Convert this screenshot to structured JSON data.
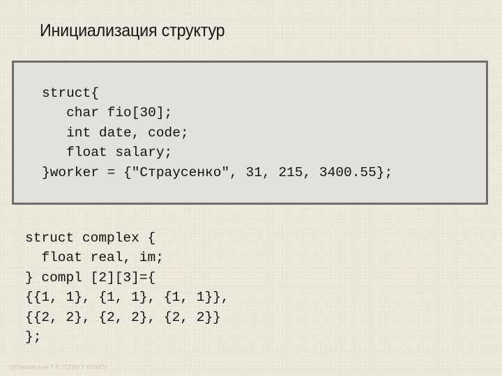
{
  "slide": {
    "title": "Инициализация структур",
    "background_color": "#ece6da",
    "title_color": "#16140f"
  },
  "code_box": {
    "border_color": "#6e6e6e",
    "background_color": "#e3e1dc",
    "code": "struct{\n   char fio[30];\n   int date, code;\n   float salary;\n}worker = {\"Страусенко\", 31, 215, 3400.55};"
  },
  "code_plain": {
    "code": "struct complex {\n  float real, im;\n} compl [2][3]={\n{{1, 1}, {1, 1}, {1, 1}},\n{{2, 2}, {2, 2}, {2, 2}}\n};"
  },
  "footer": {
    "text": "©Павловская Т.А. (СПБГУ ИТМО)"
  }
}
